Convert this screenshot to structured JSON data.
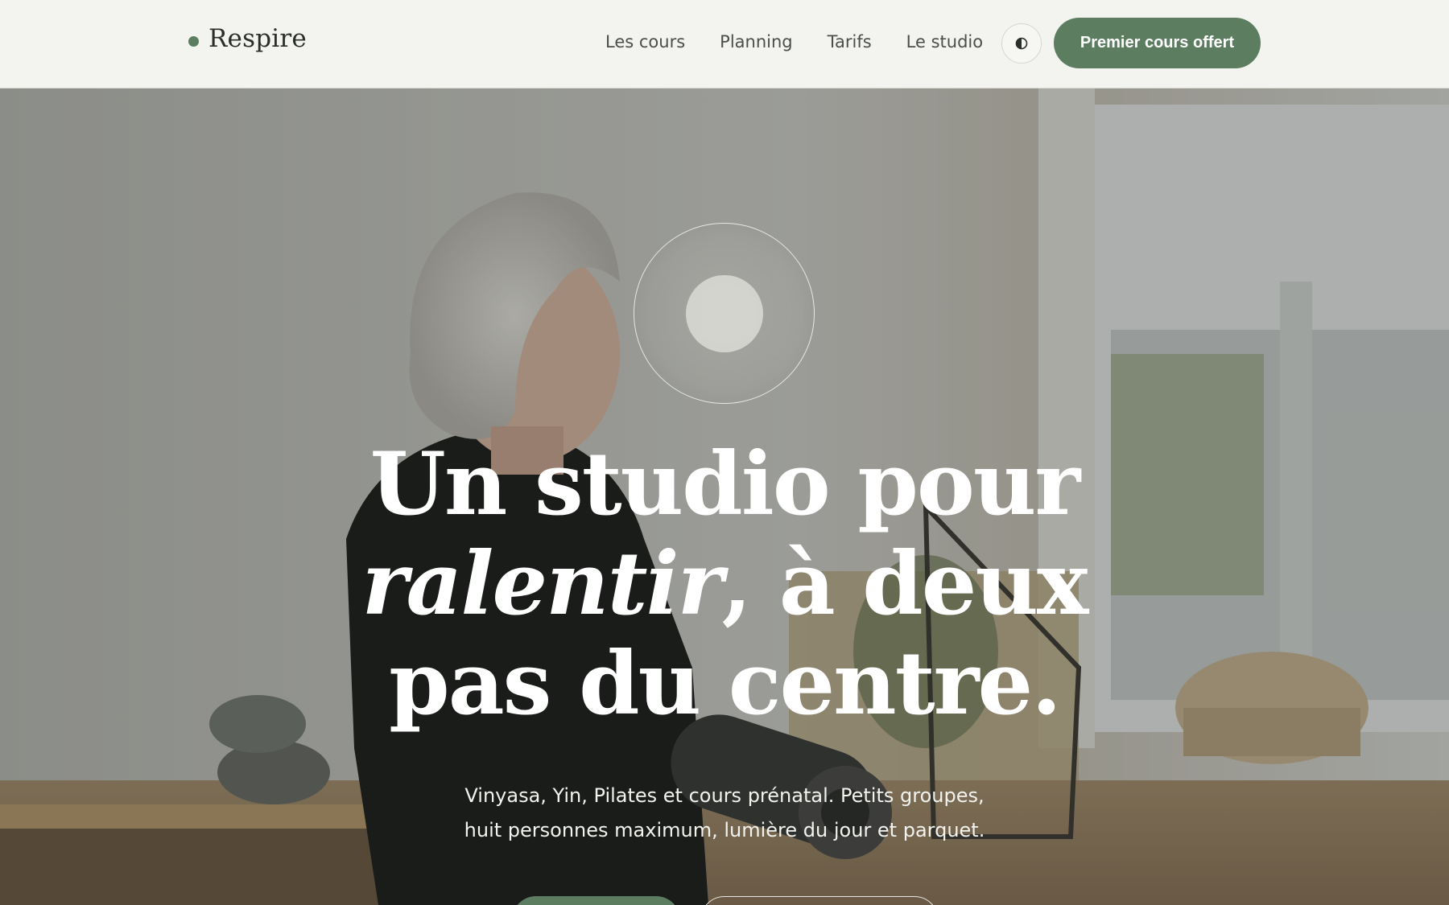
{
  "header": {
    "brand": "Respire",
    "nav": [
      "Les cours",
      "Planning",
      "Tarifs",
      "Le studio"
    ],
    "theme_toggle_icon": "contrast-icon",
    "cta_label": "Premier cours offert"
  },
  "hero": {
    "headline_line1": "Un studio pour",
    "headline_em": "ralentir",
    "headline_line2_rest": ", à deux",
    "headline_line3": "pas du centre.",
    "subtitle_line1": "Vinyasa, Yin, Pilates et cours prénatal. Petits groupes,",
    "subtitle_line2": "huit personnes maximum, lumière du jour et parquet.",
    "background_image": "woman-holding-yoga-mat-photo"
  },
  "colors": {
    "accent": "#5d7d61",
    "header_bg": "#f3f3ef",
    "text_dark": "#2a2e2b"
  }
}
